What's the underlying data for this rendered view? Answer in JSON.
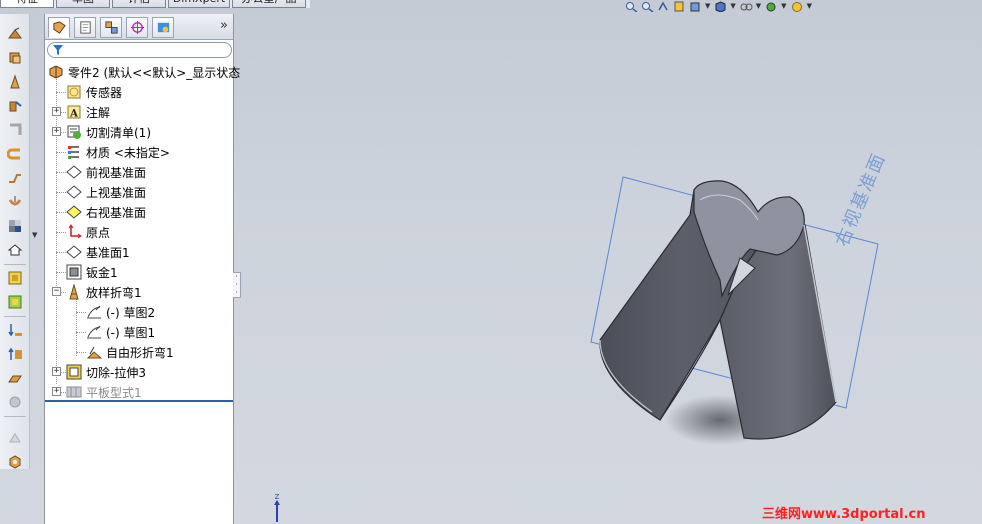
{
  "top_tabs": [
    "特征",
    "草图",
    "评估",
    "DimXpert",
    "办公室产品"
  ],
  "feature_manager": {
    "tabs": [
      "featuremanager-tab",
      "propertymanager-tab",
      "configurationmanager-tab",
      "dimxpertmanager-tab",
      "displaymanager-tab"
    ],
    "collapse_glyph": "»",
    "root": "零件2  (默认<<默认>_显示状态",
    "items": [
      {
        "label": "传感器",
        "icon": "sensor-icon"
      },
      {
        "label": "注解",
        "icon": "annotation-icon"
      },
      {
        "label": "切割清单(1)",
        "icon": "cutlist-icon"
      },
      {
        "label": "材质 <未指定>",
        "icon": "material-icon"
      },
      {
        "label": "前视基准面",
        "icon": "plane-icon"
      },
      {
        "label": "上视基准面",
        "icon": "plane-icon"
      },
      {
        "label": "右视基准面",
        "icon": "plane-icon"
      },
      {
        "label": "原点",
        "icon": "origin-icon"
      },
      {
        "label": "基准面1",
        "icon": "plane-icon"
      },
      {
        "label": "钣金1",
        "icon": "sheetmetal-icon"
      },
      {
        "label": "放样折弯1",
        "icon": "lofted-bend-icon"
      },
      {
        "label": "(-) 草图2",
        "icon": "sketch-icon"
      },
      {
        "label": "(-) 草图1",
        "icon": "sketch-icon"
      },
      {
        "label": "自由形折弯1",
        "icon": "flat-pattern-feature-icon"
      },
      {
        "label": "切除-拉伸3",
        "icon": "cut-extrude-icon"
      },
      {
        "label": "平板型式1",
        "icon": "flat-pattern-icon"
      }
    ]
  },
  "viewport": {
    "plane_label": "右视基准面",
    "triad_axis": "Z",
    "watermark": "三维网www.3dportal.cn",
    "colors": {
      "part": "#5c5f69",
      "plane": "#5a86d6",
      "watermark": "#ff2020"
    }
  }
}
